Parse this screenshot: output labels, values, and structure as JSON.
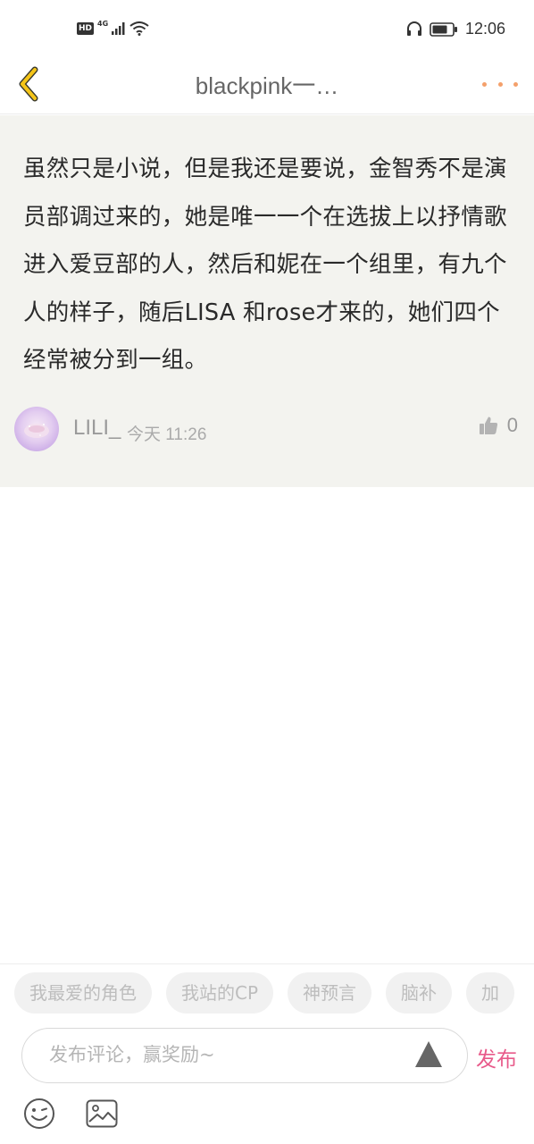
{
  "status_bar": {
    "hd": "HD",
    "network": "4G",
    "time": "12:06",
    "icons": [
      "hd-icon",
      "signal-icon",
      "wifi-icon",
      "headphones-icon",
      "battery-icon"
    ]
  },
  "header": {
    "title": "blackpink一…",
    "back_icon": "chevron-left-icon",
    "more_icon": "more-dots-icon",
    "accent_back": "#f5c518",
    "accent_more": "#f4a06b"
  },
  "comment": {
    "text": "虽然只是小说，但是我还是要说，金智秀不是演员部调过来的，她是唯一一个在选拔上以抒情歌进入爱豆部的人，然后和妮在一个组里，有九个人的样子，随后LISA 和rose才来的，她们四个经常被分到一组。",
    "author": "LILI_",
    "time": "今天 11:26",
    "likes": "0",
    "background": "#f3f3ef"
  },
  "tags": [
    "我最爱的角色",
    "我站的CP",
    "神预言",
    "脑补",
    "加"
  ],
  "input": {
    "placeholder": "发布评论，赢奖励~",
    "publish_label": "发布",
    "publish_color": "#e85a8a"
  },
  "toolbar": {
    "icons": [
      "emoji-icon",
      "image-icon"
    ]
  }
}
